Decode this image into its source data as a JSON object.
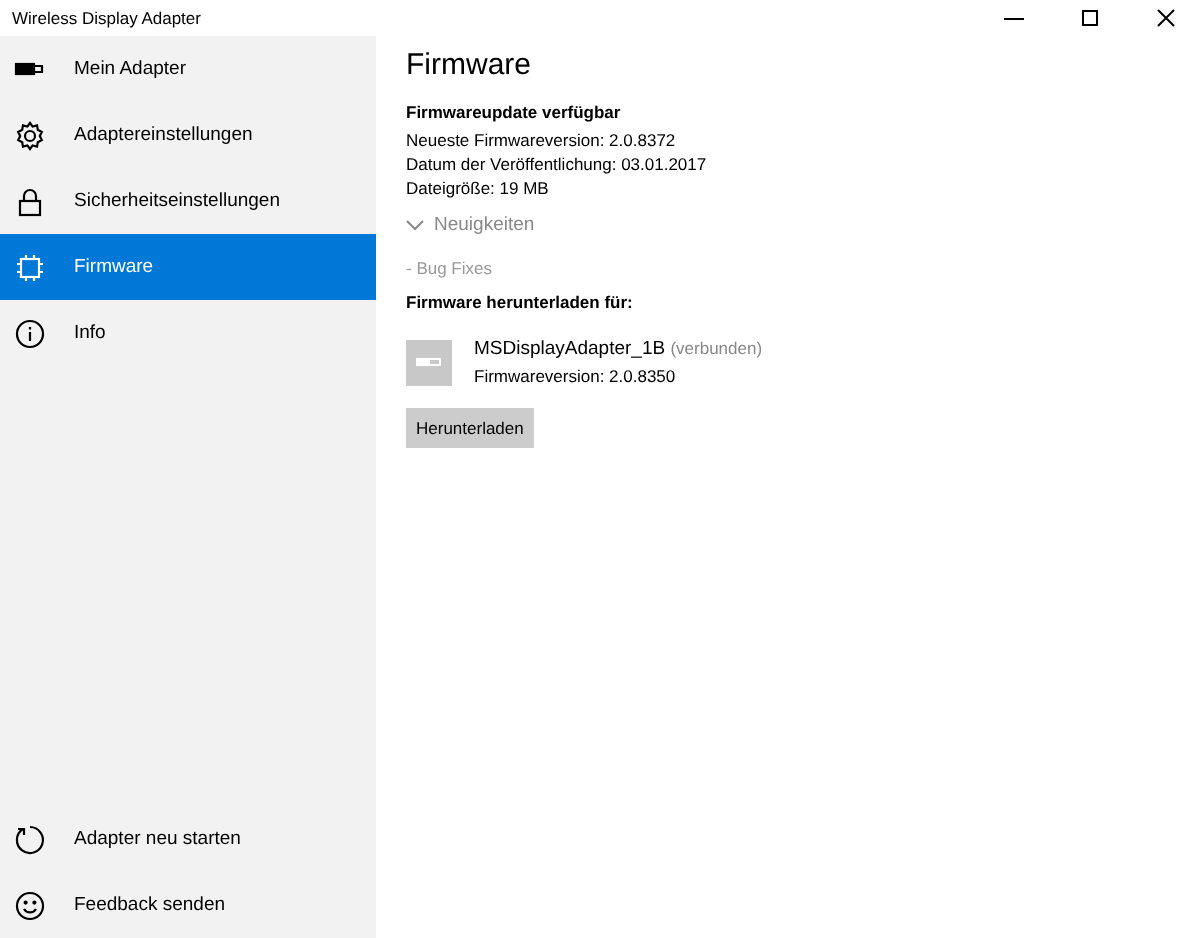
{
  "window": {
    "title": "Wireless Display Adapter"
  },
  "sidebar": {
    "items": [
      {
        "label": "Mein Adapter",
        "selected": false
      },
      {
        "label": "Adaptereinstellungen",
        "selected": false
      },
      {
        "label": "Sicherheitseinstellungen",
        "selected": false
      },
      {
        "label": "Firmware",
        "selected": true
      },
      {
        "label": "Info",
        "selected": false
      }
    ],
    "footer_items": [
      {
        "label": "Adapter neu starten"
      },
      {
        "label": "Feedback senden"
      }
    ]
  },
  "content": {
    "title": "Firmware",
    "update_heading": "Firmwareupdate verfügbar",
    "details": [
      "Neueste Firmwareversion:  2.0.8372",
      "Datum der Veröffentlichung: 03.01.2017",
      "Dateigröße: 19 MB"
    ],
    "news": {
      "label": "Neuigkeiten",
      "expanded": false
    },
    "news_text": "- Bug Fixes",
    "download_heading": "Firmware herunterladen für:",
    "device": {
      "name": "MSDisplayAdapter_1B",
      "status": "(verbunden)",
      "version": "Firmwareversion: 2.0.8350"
    },
    "button": "Herunterladen"
  }
}
